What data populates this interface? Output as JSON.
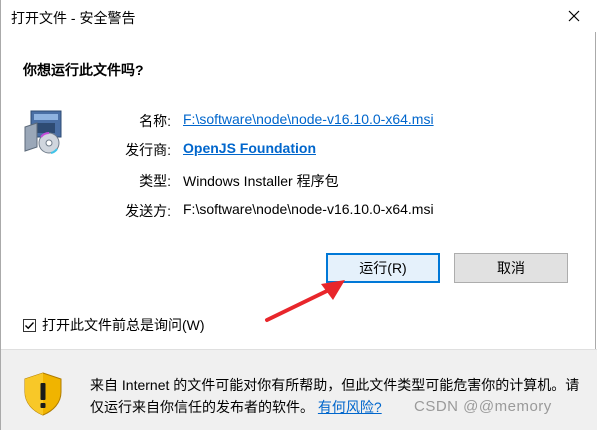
{
  "window": {
    "title": "打开文件 - 安全警告",
    "close_icon": "close-icon"
  },
  "prompt": {
    "question": "你想运行此文件吗?"
  },
  "file_info": {
    "icon": "msi-installer-icon",
    "name_label": "名称:",
    "name_value": "F:\\software\\node\\node-v16.10.0-x64.msi",
    "publisher_label": "发行商:",
    "publisher_value": "OpenJS Foundation",
    "type_label": "类型:",
    "type_value": "Windows Installer 程序包",
    "from_label": "发送方:",
    "from_value": "F:\\software\\node\\node-v16.10.0-x64.msi"
  },
  "buttons": {
    "run_label": "运行(R)",
    "cancel_label": "取消"
  },
  "checkbox": {
    "label": "打开此文件前总是询问(W)",
    "checked": true
  },
  "footer": {
    "icon": "warning-shield-icon",
    "text": "来自 Internet 的文件可能对你有所帮助，但此文件类型可能危害你的计算机。请仅运行来自你信任的发布者的软件。",
    "link_label": "有何风险?"
  },
  "annotation": {
    "arrow": "red-arrow-icon",
    "color": "#e8262b"
  },
  "watermark": "CSDN @@memory"
}
